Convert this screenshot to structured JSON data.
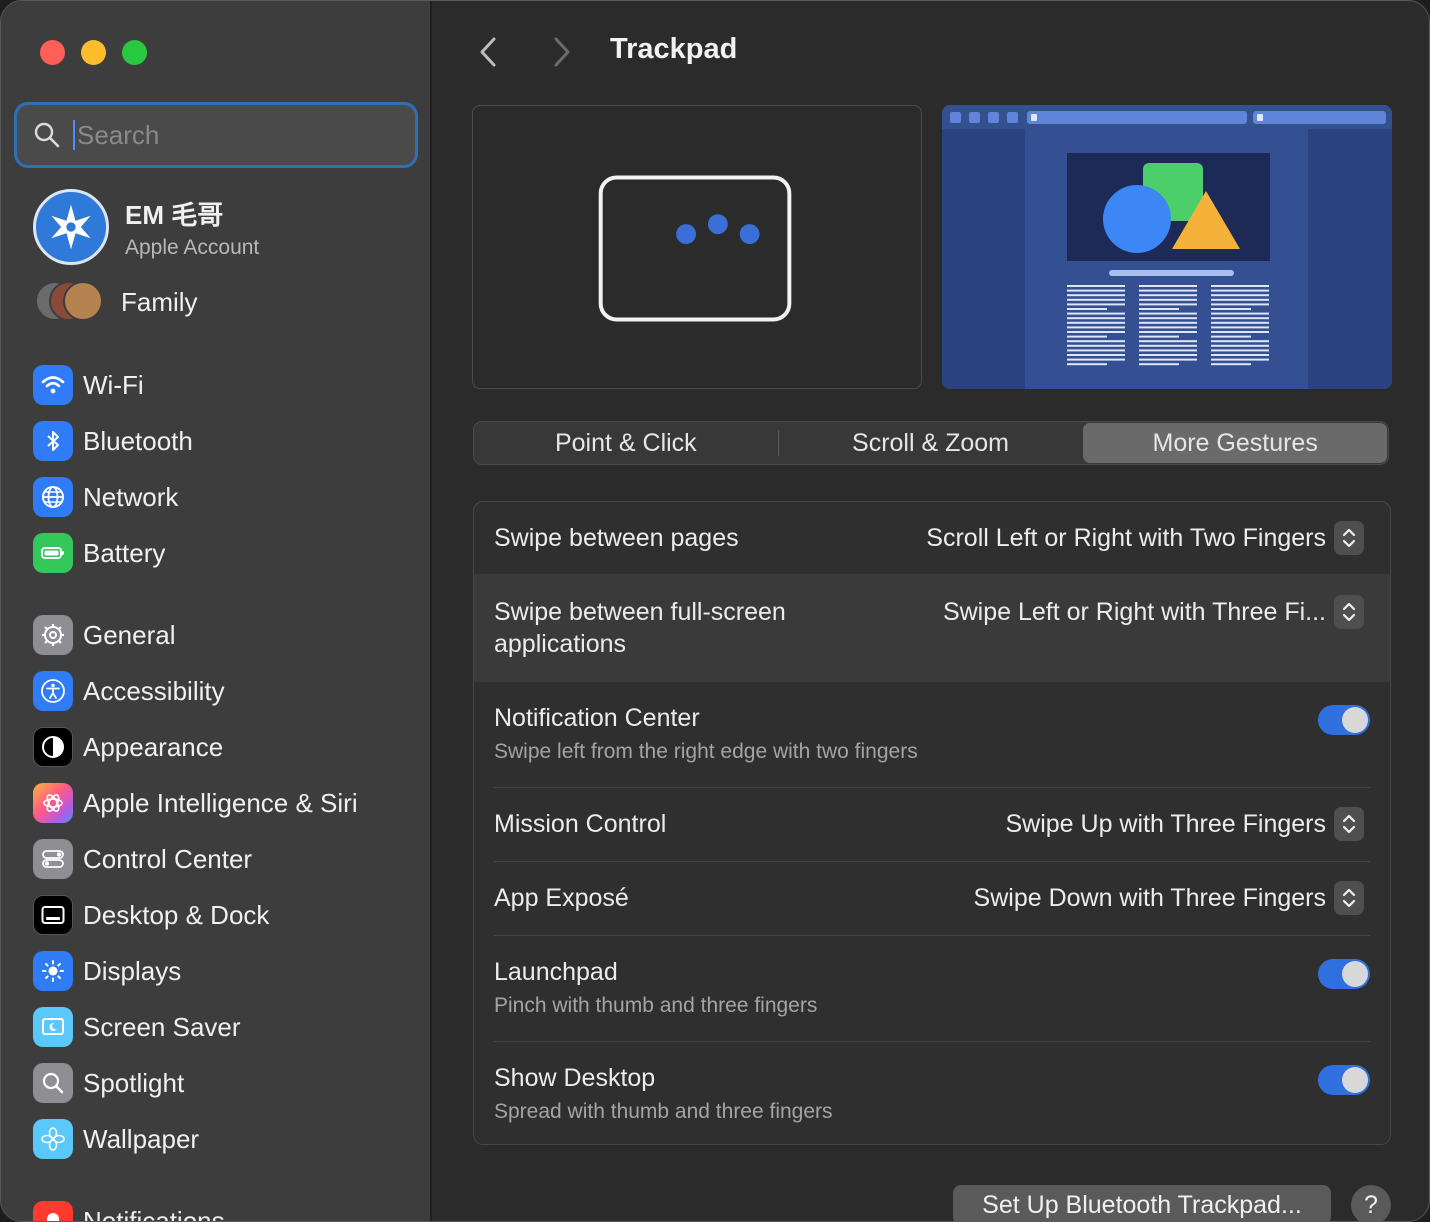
{
  "sidebar": {
    "search_placeholder": "Search",
    "account": {
      "name": "EM 毛哥",
      "subtitle": "Apple Account"
    },
    "family_label": "Family",
    "items": [
      {
        "label": "Wi-Fi",
        "icon": "wifi-icon",
        "color": "#2f7cf6"
      },
      {
        "label": "Bluetooth",
        "icon": "bluetooth-icon",
        "color": "#2f7cf6"
      },
      {
        "label": "Network",
        "icon": "globe-icon",
        "color": "#2f7cf6"
      },
      {
        "label": "Battery",
        "icon": "battery-icon",
        "color": "#34c759"
      },
      {
        "label": "General",
        "icon": "gear-icon",
        "color": "#8e8e93"
      },
      {
        "label": "Accessibility",
        "icon": "accessibility-icon",
        "color": "#2f7cf6"
      },
      {
        "label": "Appearance",
        "icon": "appearance-icon",
        "color": "#000000"
      },
      {
        "label": "Apple Intelligence & Siri",
        "icon": "siri-icon",
        "color": "#c64bd6"
      },
      {
        "label": "Control Center",
        "icon": "control-center-icon",
        "color": "#8e8e93"
      },
      {
        "label": "Desktop & Dock",
        "icon": "dock-icon",
        "color": "#000000"
      },
      {
        "label": "Displays",
        "icon": "sun-icon",
        "color": "#2f7cf6"
      },
      {
        "label": "Screen Saver",
        "icon": "screen-saver-icon",
        "color": "#5ac8fa"
      },
      {
        "label": "Spotlight",
        "icon": "magnifier-icon",
        "color": "#8e8e93"
      },
      {
        "label": "Wallpaper",
        "icon": "flower-icon",
        "color": "#5ac8fa"
      },
      {
        "label": "Notifications",
        "icon": "bell-icon",
        "color": "#ff3b30"
      }
    ]
  },
  "header": {
    "title": "Trackpad"
  },
  "tabs": [
    "Point & Click",
    "Scroll & Zoom",
    "More Gestures"
  ],
  "active_tab": "More Gestures",
  "gestures": [
    {
      "label": "Swipe between pages",
      "value": "Scroll Left or Right with Two Fingers"
    },
    {
      "label": "Swipe between full-screen applications",
      "value": "Swipe Left or Right with Three Fi..."
    },
    {
      "label": "Notification Center",
      "subtitle": "Swipe left from the right edge with two fingers",
      "enabled": true
    },
    {
      "label": "Mission Control",
      "value": "Swipe Up with Three Fingers"
    },
    {
      "label": "App Exposé",
      "value": "Swipe Down with Three Fingers"
    },
    {
      "label": "Launchpad",
      "subtitle": "Pinch with thumb and three fingers",
      "enabled": true
    },
    {
      "label": "Show Desktop",
      "subtitle": "Spread with thumb and three fingers",
      "enabled": true
    }
  ],
  "footer": {
    "setup_button": "Set Up Bluetooth Trackpad...",
    "help_button": "?"
  }
}
